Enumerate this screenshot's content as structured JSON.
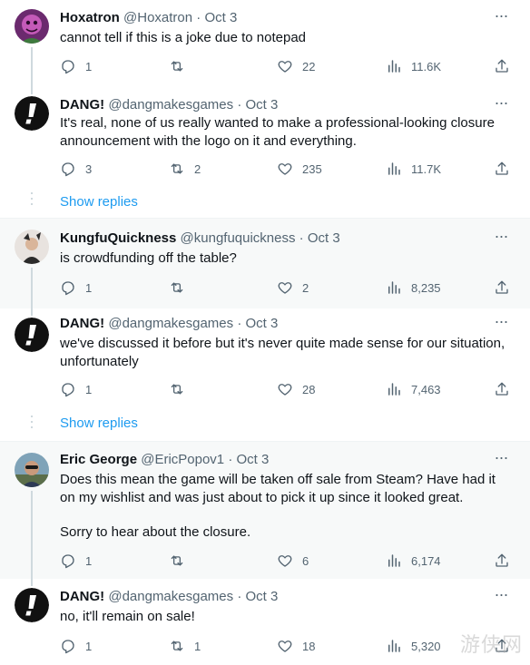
{
  "colors": {
    "text": "#0f1419",
    "muted": "#536471",
    "link": "#1d9bf0",
    "shaded_bg": "#f7f9f9",
    "line": "#cfd9de"
  },
  "tweets": [
    {
      "name": "Hoxatron",
      "handle": "@Hoxatron",
      "sep": "·",
      "time": "Oct 3",
      "avatar": "purple-character-avatar",
      "text": [
        "cannot tell if this is a joke due to notepad"
      ],
      "stats": {
        "replies": "1",
        "retweets": "",
        "likes": "22",
        "views": "11.6K"
      }
    },
    {
      "name": "DANG!",
      "handle": "@dangmakesgames",
      "sep": "·",
      "time": "Oct 3",
      "avatar": "dang-logo-avatar",
      "text": [
        "It's real, none of us really wanted to make a professional-looking closure announcement with the logo on it and everything."
      ],
      "stats": {
        "replies": "3",
        "retweets": "2",
        "likes": "235",
        "views": "11.7K"
      }
    },
    {
      "name": "KungfuQuickness",
      "handle": "@kungfuquickness",
      "sep": "·",
      "time": "Oct 3",
      "avatar": "kungfu-avatar",
      "text": [
        "is crowdfunding off the table?"
      ],
      "stats": {
        "replies": "1",
        "retweets": "",
        "likes": "2",
        "views": "8,235"
      }
    },
    {
      "name": "DANG!",
      "handle": "@dangmakesgames",
      "sep": "·",
      "time": "Oct 3",
      "avatar": "dang-logo-avatar",
      "text": [
        "we've discussed it before but it's never quite made sense for our situation, unfortunately"
      ],
      "stats": {
        "replies": "1",
        "retweets": "",
        "likes": "28",
        "views": "7,463"
      }
    },
    {
      "name": "Eric George",
      "handle": "@EricPopov1",
      "sep": "·",
      "time": "Oct 3",
      "avatar": "eric-photo-avatar",
      "text": [
        "Does this mean the game will be taken off sale from Steam? Have had it on my wishlist and was just about to pick it up since it looked great.",
        "Sorry to hear about the closure."
      ],
      "stats": {
        "replies": "1",
        "retweets": "",
        "likes": "6",
        "views": "6,174"
      }
    },
    {
      "name": "DANG!",
      "handle": "@dangmakesgames",
      "sep": "·",
      "time": "Oct 3",
      "avatar": "dang-logo-avatar",
      "text": [
        "no, it'll remain on sale!"
      ],
      "stats": {
        "replies": "1",
        "retweets": "1",
        "likes": "18",
        "views": "5,320"
      }
    }
  ],
  "show_replies_label": "Show replies",
  "more_label": "···",
  "watermark": "游侠网"
}
